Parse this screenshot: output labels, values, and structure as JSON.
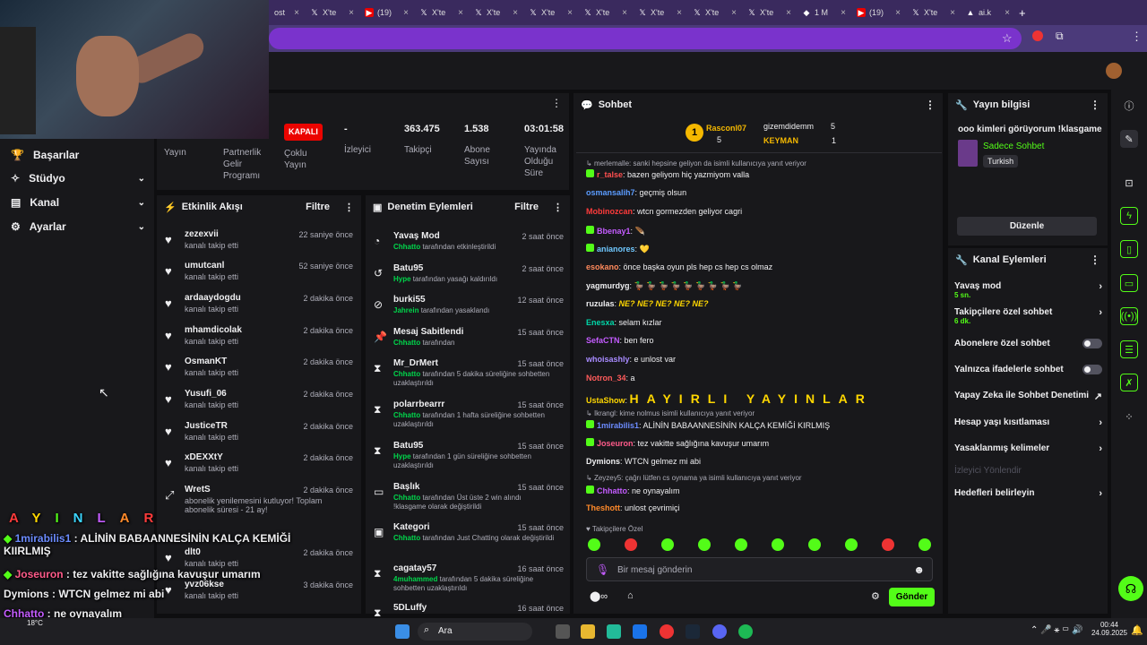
{
  "browser": {
    "tabs": [
      {
        "icon": "x-icon",
        "label": "X'te"
      },
      {
        "icon": "youtube-icon",
        "label": "(19)"
      },
      {
        "icon": "x-icon",
        "label": "X'te"
      },
      {
        "icon": "x-icon",
        "label": "X'te"
      },
      {
        "icon": "x-icon",
        "label": "X'te"
      },
      {
        "icon": "x-icon",
        "label": "X'te"
      },
      {
        "icon": "x-icon",
        "label": "X'te"
      },
      {
        "icon": "x-icon",
        "label": "X'te"
      },
      {
        "icon": "x-icon",
        "label": "X'te"
      },
      {
        "icon": "generic-icon",
        "label": "1 M"
      },
      {
        "icon": "youtube-icon",
        "label": "(19)"
      },
      {
        "icon": "x-icon",
        "label": "X'te"
      },
      {
        "icon": "ai-icon",
        "label": "ai.k"
      }
    ],
    "first_tab_label": "ost",
    "new_tab": "+",
    "close": "×"
  },
  "sidebar": {
    "items": [
      {
        "label": "Başarılar",
        "icon": "trophy-icon"
      },
      {
        "label": "Stüdyo",
        "icon": "studio-icon"
      },
      {
        "label": "Kanal",
        "icon": "channel-icon"
      },
      {
        "label": "Ayarlar",
        "icon": "gear-icon"
      }
    ]
  },
  "stream_panel": {
    "tabs": [
      "Yayın",
      "Partnerlik Gelir Programı",
      "Çoklu Yayın"
    ],
    "status_badge": "KAPALI",
    "stats": [
      {
        "value": "-",
        "label": "İzleyici"
      },
      {
        "value": "363.475",
        "label": "Takipçi"
      },
      {
        "value": "1.538",
        "label": "Abone Sayısı"
      },
      {
        "value": "03:01:58",
        "label": "Yayında Olduğu Süre"
      }
    ]
  },
  "activity": {
    "title": "Etkinlik Akışı",
    "filter": "Filtre",
    "items": [
      {
        "name": "zezexvii",
        "sub": "kanalı takip etti",
        "time": "22 saniye önce"
      },
      {
        "name": "umutcanl",
        "sub": "kanalı takip etti",
        "time": "52 saniye önce"
      },
      {
        "name": "ardaaydogdu",
        "sub": "kanalı takip etti",
        "time": "2 dakika önce"
      },
      {
        "name": "mhamdicolak",
        "sub": "kanalı takip etti",
        "time": "2 dakika önce"
      },
      {
        "name": "OsmanKT",
        "sub": "kanalı takip etti",
        "time": "2 dakika önce"
      },
      {
        "name": "Yusufi_06",
        "sub": "kanalı takip etti",
        "time": "2 dakika önce"
      },
      {
        "name": "JusticeTR",
        "sub": "kanalı takip etti",
        "time": "2 dakika önce"
      },
      {
        "name": "xDEXXtY",
        "sub": "kanalı takip etti",
        "time": "2 dakika önce"
      },
      {
        "name": "WretS",
        "sub": "abonelik yenilemesini kutluyor! Toplam abonelik süresi - 21 ay!",
        "time": "2 dakika önce"
      },
      {
        "name": "dlt0",
        "sub": "kanalı takip etti",
        "time": "2 dakika önce"
      },
      {
        "name": "yvz06kse",
        "sub": "kanalı takip etti",
        "time": "3 dakika önce"
      }
    ]
  },
  "moderation": {
    "title": "Denetim Eylemleri",
    "filter": "Filtre",
    "items": [
      {
        "icon": "slow-mode-icon",
        "name": "Yavaş Mod",
        "actor": "Chhatto",
        "sub": "tarafından etkinleştirildi",
        "time": "2 saat önce"
      },
      {
        "icon": "unban-icon",
        "name": "Batu95",
        "actor": "Hype",
        "sub": "tarafından yasağı kaldırıldı",
        "time": "2 saat önce"
      },
      {
        "icon": "ban-icon",
        "name": "burki55",
        "actor": "Jahrein",
        "sub": "tarafından yasaklandı",
        "time": "12 saat önce"
      },
      {
        "icon": "pin-icon",
        "name": "Mesaj Sabitlendi",
        "actor": "Chhatto",
        "sub": "tarafından",
        "time": "15 saat önce"
      },
      {
        "icon": "timeout-icon",
        "name": "Mr_DrMert",
        "actor": "Chhatto",
        "sub": "tarafından 5 dakika süreliğine sohbetten uzaklaştırıldı",
        "time": "15 saat önce"
      },
      {
        "icon": "timeout-icon",
        "name": "polarrbearrr",
        "actor": "Chhatto",
        "sub": "tarafından 1 hafta süreliğine sohbetten uzaklaştırıldı",
        "time": "15 saat önce"
      },
      {
        "icon": "timeout-icon",
        "name": "Batu95",
        "actor": "Hype",
        "sub": "tarafından 1 gün süreliğine sohbetten uzaklaştırıldı",
        "time": "15 saat önce"
      },
      {
        "icon": "title-icon",
        "name": "Başlık",
        "actor": "Chhatto",
        "sub": "tarafından Üst üste 2 win alındı !klasgame olarak değiştirildi",
        "time": "15 saat önce"
      },
      {
        "icon": "category-icon",
        "name": "Kategori",
        "actor": "Chhatto",
        "sub": "tarafından Just Chatting olarak değiştirildi",
        "time": "15 saat önce"
      },
      {
        "icon": "timeout-icon",
        "name": "cagatay57",
        "actor": "4muhammed",
        "sub": "tarafından 5 dakika süreliğine sohbetten uzaklaştırıldı",
        "time": "16 saat önce"
      },
      {
        "icon": "timeout-icon",
        "name": "5DLuffy",
        "actor": "",
        "sub": "",
        "time": "16 saat önce"
      }
    ]
  },
  "chat": {
    "title": "Sohbet",
    "top_gifters": [
      {
        "name": "Rasconl07",
        "count": "5"
      },
      {
        "name": "gizemdidemm",
        "count": "5"
      },
      {
        "name": "KEYMAN",
        "count": "1"
      }
    ],
    "messages": [
      {
        "type": "reply",
        "text": "merlemalle: sanki hepsine geliyon da isimli kullanıcıya yanıt veriyor"
      },
      {
        "user": "r_talse",
        "color": "#ff4f4f",
        "text": "bazen geliyom hiç yazmiyom valla"
      },
      {
        "user": "osmansalih7",
        "color": "#5b9cff",
        "text": "geçmiş olsun"
      },
      {
        "user": "Mobinozcan",
        "color": "#ff3b3b",
        "text": "wtcn gormezden geliyor cagri"
      },
      {
        "user": "Bbenay1",
        "color": "#c45cff",
        "text": ""
      },
      {
        "user": "anianores",
        "color": "#6fc8ff",
        "text": ""
      },
      {
        "user": "esokano",
        "color": "#ff8a5c",
        "text": "önce başka oyun pls hep cs hep cs olmaz"
      },
      {
        "user": "yagmurdyg",
        "color": "#efeff1",
        "text": "🦆 🦆 🦆 🦆 🦆 🦆 🦆 🦆 🦆"
      },
      {
        "user": "ruzulas",
        "color": "#efeff1",
        "text": "NE? NE? NE? NE? NE?"
      },
      {
        "user": "Enesxa",
        "color": "#00d6a8",
        "text": "selam kızlar"
      },
      {
        "user": "SefaCTN",
        "color": "#c45cff",
        "text": "ben fero"
      },
      {
        "user": "whoisashly",
        "color": "#a88bff",
        "text": "e unlost var"
      },
      {
        "user": "Notron_34",
        "color": "#ff5b5b",
        "text": "a"
      },
      {
        "user": "UstaShow",
        "color": "#ffd700",
        "text": "HAYIRLI YAYINLAR"
      },
      {
        "type": "reply",
        "text": "Ikrangl: kime nolmus isimli kullanıcıya yanıt veriyor"
      },
      {
        "user": "1mirabilis1",
        "color": "#6c8cff",
        "text": "ALİNİN BABAANNESİNİN KALÇA KEMİĞİ KIRLMIŞ"
      },
      {
        "user": "Joseuron",
        "color": "#ff5b8a",
        "text": "tez vakitte sağlığına kavuşur umarım"
      },
      {
        "user": "Dymions",
        "color": "#efeff1",
        "text": "WTCN gelmez mi abi"
      },
      {
        "type": "reply",
        "text": "Zeyzey5: çağrı lütfen cs oynama ya isimli kullanıcıya yanıt veriyor"
      },
      {
        "user": "Chhatto",
        "color": "#c45cff",
        "text": "ne oynayalım"
      },
      {
        "user": "Theshott",
        "color": "#ff8a2a",
        "text": "unlost çevrimiçi"
      }
    ],
    "follower_only_label": "Takipçilere Özel",
    "input_placeholder": "Bir mesaj gönderin",
    "send_label": "Gönder"
  },
  "stream_info": {
    "title": "Yayın bilgisi",
    "stream_title": "ooo kimleri görüyorum !klasgame",
    "category": "Sadece Sohbet",
    "tag": "Turkish",
    "edit_label": "Düzenle"
  },
  "channel_actions": {
    "title": "Kanal Eylemleri",
    "items": [
      {
        "label": "Yavaş mod",
        "sub": "5 sn.",
        "kind": "arrow"
      },
      {
        "label": "Takipçilere özel sohbet",
        "sub": "6 dk.",
        "kind": "arrow"
      },
      {
        "label": "Abonelere özel sohbet",
        "sub": "",
        "kind": "toggle"
      },
      {
        "label": "Yalnızca ifadelerle sohbet",
        "sub": "",
        "kind": "toggle"
      },
      {
        "label": "Yapay Zeka ile Sohbet Denetimi",
        "sub": "",
        "kind": "external"
      },
      {
        "label": "Hesap yaşı kısıtlaması",
        "sub": "",
        "kind": "arrow"
      },
      {
        "label": "Yasaklanmış kelimeler",
        "sub": "",
        "kind": "arrow"
      },
      {
        "label": "İzleyici Yönlendir",
        "sub": "",
        "kind": "disabled"
      },
      {
        "label": "Hedefleri belirleyin",
        "sub": "",
        "kind": "arrow"
      }
    ]
  },
  "overlay": {
    "rainbow": "AYINLAR",
    "lines": [
      {
        "user": "1mirabilis1",
        "text": "ALİNİN BABAANNESİNİN KALÇA KEMİĞİ",
        "text2": "KIIRLMIŞ",
        "color": "#6c8cff"
      },
      {
        "user": "Joseuron",
        "text": "tez vakitte sağlığına kavuşur umarım",
        "color": "#ff5b8a"
      },
      {
        "user": "Dymions",
        "text": "WTCN gelmez mi abi",
        "color": "#efeff1"
      },
      {
        "user": "Chhatto",
        "text": "ne oynayalım",
        "color": "#c45cff"
      },
      {
        "user": "Theshott",
        "text": "unlost çevrimiçi",
        "color": "#ff8a2a"
      }
    ]
  },
  "taskbar": {
    "search_label": "Ara",
    "time": "00:44",
    "date": "24.09.2025",
    "weather": "18°C"
  },
  "colors": {
    "accent": "#53fc18",
    "live_red": "#eb0400",
    "bg": "#0e0e10",
    "panel": "#18181b"
  }
}
